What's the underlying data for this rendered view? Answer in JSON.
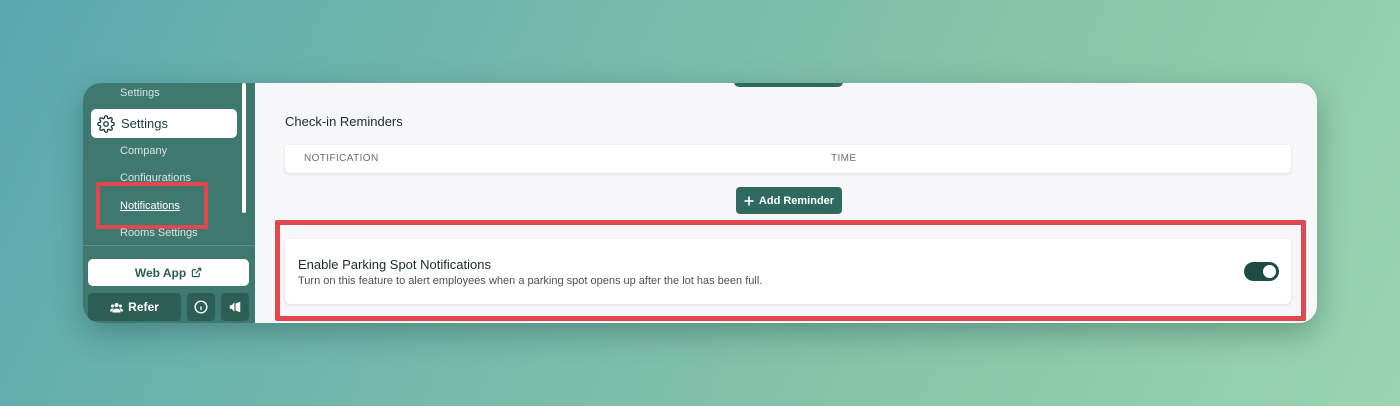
{
  "sidebar": {
    "sub_items": {
      "settings_top": "Settings",
      "company": "Company",
      "configurations": "Configurations",
      "notifications": "Notifications",
      "rooms_settings": "Rooms Settings"
    },
    "active_item": {
      "label": "Settings",
      "icon": "gear-icon"
    },
    "web_app_label": "Web App",
    "refer_label": "Refer"
  },
  "main": {
    "section_title": "Check-in Reminders",
    "table_columns": [
      "NOTIFICATION",
      "TIME"
    ],
    "add_reminder_label": "Add Reminder",
    "parking": {
      "title": "Enable Parking Spot Notifications",
      "description": "Turn on this feature to alert employees when a parking spot opens up after the lot has been full.",
      "enabled": true
    }
  },
  "colors": {
    "brand": "#3f786e",
    "accent_dark": "#2f6a60",
    "highlight": "#e0474f"
  }
}
